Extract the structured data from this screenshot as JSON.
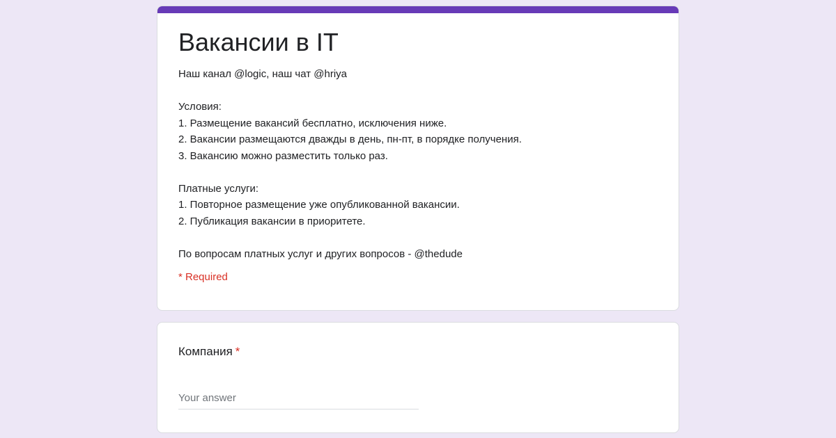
{
  "form": {
    "title": "Вакансии в IT",
    "description_lines": [
      "Наш канал @logic, наш чат @hriya",
      "",
      "Условия:",
      "1. Размещение вакансий бесплатно, исключения ниже.",
      "2. Вакансии размещаются дважды в день, пн-пт, в порядке получения.",
      "3. Вакансию можно разместить только раз.",
      "",
      "Платные услуги:",
      "1. Повторное размещение уже опубликованной вакансии.",
      "2. Публикация вакансии в приоритете.",
      "",
      "По вопросам платных услуг и других вопросов - @thedude"
    ],
    "required_note": "* Required",
    "accent_color": "#673ab7",
    "background_color": "#ede7f6",
    "required_color": "#d93025"
  },
  "questions": [
    {
      "title": "Компания",
      "required_marker": "*",
      "answer_value": "",
      "answer_placeholder": "Your answer"
    }
  ]
}
